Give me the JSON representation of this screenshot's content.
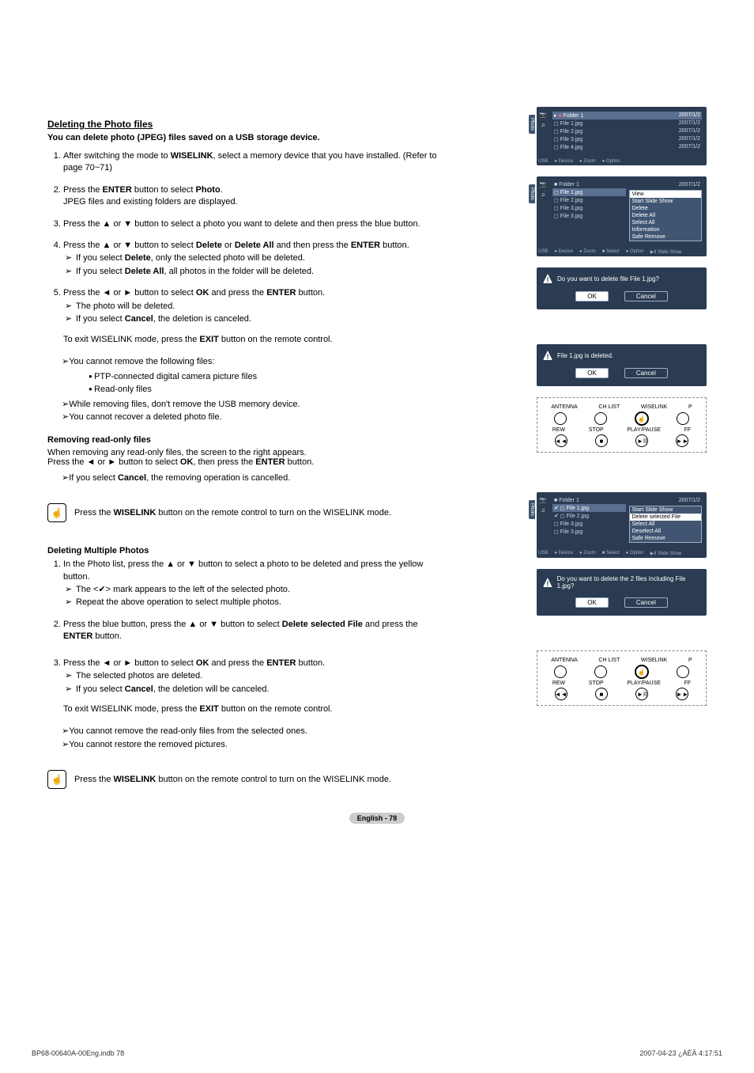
{
  "section1": {
    "title": "Deleting the Photo files",
    "intro": "You can delete photo (JPEG) files saved on a USB storage device.",
    "steps": {
      "s1": "After switching the mode to WISELINK, select a memory device that you have installed. (Refer to page 70~71)",
      "s1_bold": "WISELINK",
      "s2a": "Press the ",
      "s2_enter": "ENTER",
      "s2b": " button to select ",
      "s2_photo": "Photo",
      "s2c": ".",
      "s2d": "JPEG files and existing folders are displayed.",
      "s3": "Press the ▲ or ▼ button to select a photo you want to delete and then press the blue button.",
      "s4a": "Press the ▲ or ▼ button to select ",
      "s4_del": "Delete",
      "s4_or": " or ",
      "s4_delall": "Delete All",
      "s4b": " and then press the ",
      "s4_enter": "ENTER",
      "s4c": " button.",
      "s4sub1a": "If you select ",
      "s4sub1b": ", only the selected photo will be deleted.",
      "s4sub2a": "If you select ",
      "s4sub2b": ", all photos in the folder will be deleted.",
      "s5a": "Press the ◄ or ► button to select ",
      "s5_ok": "OK",
      "s5b": " and press the ",
      "s5_enter": "ENTER",
      "s5c": " button.",
      "s5sub1": "The photo will be deleted.",
      "s5sub2a": "If you select ",
      "s5_cancel": "Cancel",
      "s5sub2b": ", the deletion is canceled.",
      "s5exit_a": "To exit WISELINK mode, press the ",
      "s5exit_bold": "EXIT",
      "s5exit_b": " button on the remote control."
    },
    "notes": {
      "n1": "You cannot remove the following files:",
      "b1": "PTP-connected digital camera picture files",
      "b2": "Read-only files",
      "n2": "While removing files, don't remove the USB memory device.",
      "n3": "You cannot recover a deleted photo file."
    }
  },
  "readonly": {
    "title": "Removing read-only files",
    "l1": "When removing any read-only files, the screen to the right appears.",
    "l2a": "Press the ◄ or ► button to select ",
    "l2ok": "OK",
    "l2b": ", then press the ",
    "l2enter": "ENTER",
    "l2c": " button.",
    "l3a": "If you select ",
    "l3cancel": "Cancel",
    "l3b": ", the removing operation is cancelled."
  },
  "wiselink_bar": {
    "text_a": "Press the ",
    "text_bold": "WISELINK",
    "text_b": " button on the remote control to turn on the WISELINK mode."
  },
  "section2": {
    "title": "Deleting Multiple Photos",
    "s1": "In the Photo list, press the ▲ or ▼ button to select a photo to be deleted and press the yellow button.",
    "s1sub1": "The <✔> mark appears to the left of the selected photo.",
    "s1sub2": "Repeat the above operation to select multiple photos.",
    "s2a": "Press the blue button, press the ▲ or ▼ button to select ",
    "s2bold": "Delete selected File",
    "s2b": " and press the ",
    "s2enter": "ENTER",
    "s2c": " button.",
    "s3a": "Press the ◄ or ► button to select ",
    "s3ok": "OK",
    "s3b": " and press the ",
    "s3enter": "ENTER",
    "s3c": " button.",
    "s3sub1": "The selected photos are deleted.",
    "s3sub2a": "If you select ",
    "s3cancel": "Cancel",
    "s3sub2b": ", the deletion will be canceled.",
    "s3exit_a": "To exit WISELINK mode, press the ",
    "s3exit_bold": "EXIT",
    "s3exit_b": " button on the remote control.",
    "note1": "You cannot remove the read-only files from the selected ones.",
    "note2": "You cannot restore the removed pictures."
  },
  "screens": {
    "scr1": {
      "tab": "Photo",
      "folder": "Folder 1",
      "date": "2007/1/2",
      "files": [
        "File 1.jpg",
        "File 2.jpg",
        "File 3.jpg",
        "File 4.jpg"
      ],
      "footer": {
        "usb": "USB",
        "a": "Device",
        "b": "Zoom",
        "c": "Option"
      }
    },
    "scr2": {
      "tab": "Photo",
      "folder": "Folder 1",
      "date": "2007/1/2",
      "files": [
        "File 1.jpg",
        "File 2.jpg",
        "File 3.jpg",
        "File 3.jpg"
      ],
      "menu": [
        "View",
        "Start Slide Show",
        "Delete",
        "Delete All",
        "Select All",
        "Information",
        "Safe Remove"
      ],
      "footer": {
        "usb": "USB",
        "a": "Device",
        "b": "Zoom",
        "c": "Select",
        "d": "Option",
        "e": "Slide Show"
      }
    },
    "dlg1": {
      "msg": "Do you want to delete file File 1.jpg?",
      "ok": "OK",
      "cancel": "Cancel"
    },
    "dlg2": {
      "msg": "File 1.jpg is deleted.",
      "ok": "OK",
      "cancel": "Cancel"
    },
    "scr3": {
      "tab": "Photo",
      "folder": "Folder 1",
      "date": "2007/1/2",
      "files": [
        "File 1.jpg",
        "File 2.jpg",
        "File 3.jpg",
        "File 3.jpg"
      ],
      "menu": [
        "Start Slide Show",
        "Delete selected File",
        "Select All",
        "Deselect All",
        "Safe Remove"
      ],
      "footer": {
        "usb": "USB",
        "a": "Device",
        "b": "Zoom",
        "c": "Select",
        "d": "Option",
        "e": "Slide Show"
      }
    },
    "dlg3": {
      "msg": "Do you want to delete the 2 files including File 1.jpg?",
      "ok": "OK",
      "cancel": "Cancel"
    },
    "remote": {
      "labels": [
        "ANTENNA",
        "CH LIST",
        "WISELINK",
        "P"
      ],
      "labels2": [
        "REW",
        "STOP",
        "PLAY/PAUSE",
        "FF"
      ],
      "syms": [
        "◄◄",
        "■",
        "►II",
        "►►"
      ]
    }
  },
  "pagefooter": "English - 78",
  "bottom": {
    "left": "BP68-00640A-00Eng.indb   78",
    "right": "2007-04-23   ¿ÀÈÄ 4:17:51"
  }
}
